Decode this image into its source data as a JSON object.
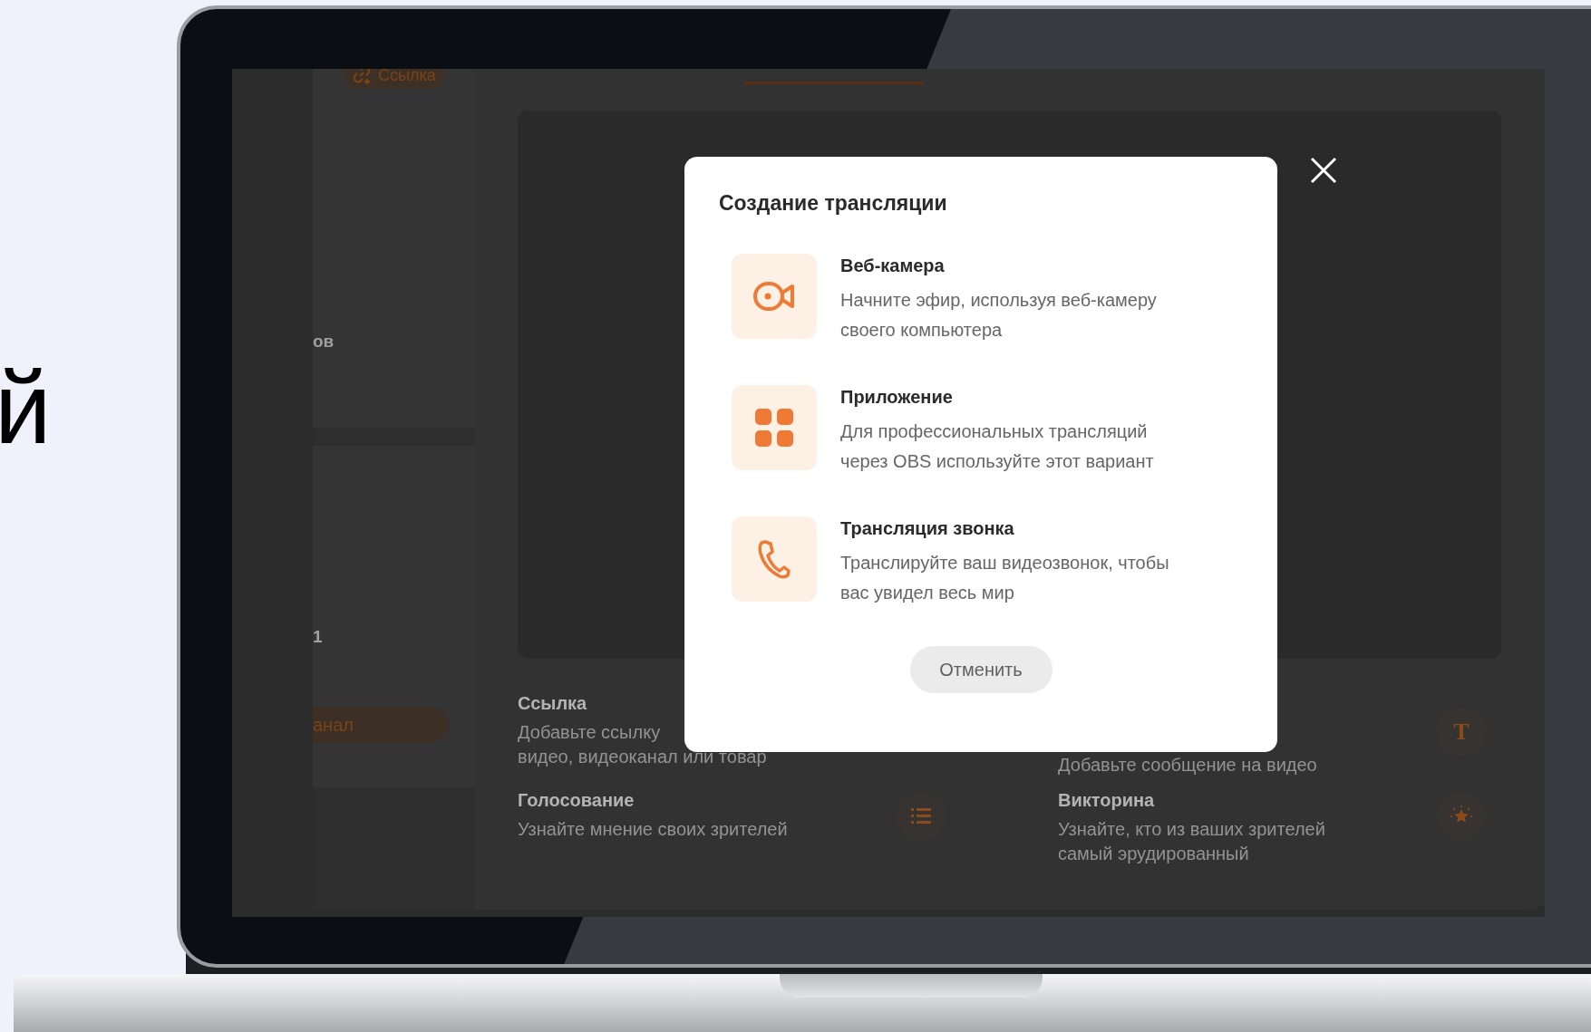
{
  "backdrop_text": "й",
  "app": {
    "top_tag": "Ссылка",
    "sidebar_fragments": [
      "ов",
      "1"
    ],
    "sidebar_button": "анал",
    "features": [
      {
        "kind": "none",
        "title": "Ссылка",
        "description_lines": [
          "Добавьте ссылку",
          "видео, видеоканал или товар"
        ]
      },
      {
        "kind": "text",
        "icon_text": "T",
        "description_lines": [
          "Добавьте сообщение на видео"
        ]
      },
      {
        "kind": "list",
        "title": "Голосование",
        "description_lines": [
          "Узнайте мнение своих зрителей"
        ]
      },
      {
        "kind": "star",
        "title": "Викторина",
        "description_lines": [
          "Узнайте, кто из ваших зрителей",
          "самый эрудированный"
        ]
      }
    ]
  },
  "dialog": {
    "title": "Создание трансляции",
    "options": [
      {
        "kind": "camera",
        "title": "Веб-камера",
        "description_lines": [
          "Начните эфир, используя веб-камеру",
          "своего компьютера"
        ]
      },
      {
        "kind": "grid",
        "title": "Приложение",
        "description_lines": [
          "Для профессиональных трансляций",
          "через OBS используйте этот вариант"
        ]
      },
      {
        "kind": "phone",
        "title": "Трансляция звонка",
        "description_lines": [
          "Транслируйте ваш видеозвонок, чтобы",
          "вас увидел весь мир"
        ]
      }
    ],
    "cancel": "Отменить"
  }
}
